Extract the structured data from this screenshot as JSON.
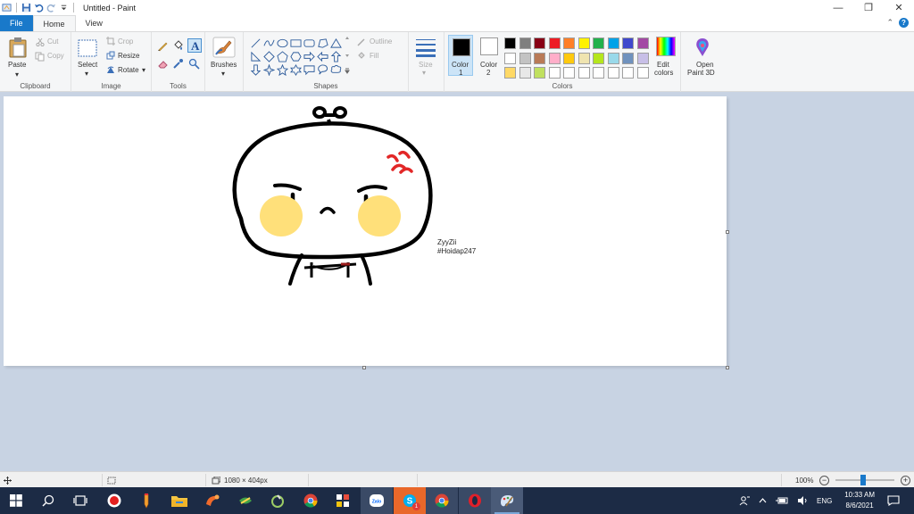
{
  "window": {
    "title": "Untitled - Paint",
    "minimize": "—",
    "restore": "❐",
    "close": "✕"
  },
  "tabs": [
    {
      "label": "File"
    },
    {
      "label": "Home"
    },
    {
      "label": "View"
    }
  ],
  "ribbon": {
    "clipboard": {
      "paste": "Paste",
      "cut": "Cut",
      "copy": "Copy",
      "group": "Clipboard"
    },
    "image": {
      "select": "Select",
      "crop": "Crop",
      "resize": "Resize",
      "rotate": "Rotate",
      "group": "Image"
    },
    "tools": {
      "group": "Tools"
    },
    "brushes": {
      "label": "Brushes"
    },
    "shapes": {
      "outline": "Outline",
      "fill": "Fill",
      "group": "Shapes"
    },
    "size": {
      "label": "Size"
    },
    "color1": {
      "label": "Color",
      "num": "1",
      "value": "#000000"
    },
    "color2": {
      "label": "Color",
      "num": "2",
      "value": "#ffffff"
    },
    "colors": {
      "group": "Colors",
      "palette": [
        "#000000",
        "#7f7f7f",
        "#880015",
        "#ed1c24",
        "#ff7f27",
        "#fff200",
        "#22b14c",
        "#00a2e8",
        "#3f48cc",
        "#a349a4",
        "#ffffff",
        "#c3c3c3",
        "#b97a57",
        "#ffaec9",
        "#ffc90e",
        "#efe4b0",
        "#b5e61d",
        "#99d9ea",
        "#7092be",
        "#c8bfe7",
        "#ffd966",
        "#e8e8e8",
        "#c0e060",
        "#ffffff",
        "#ffffff",
        "#ffffff",
        "#ffffff",
        "#ffffff",
        "#ffffff",
        "#ffffff"
      ]
    },
    "edit_colors": {
      "line1": "Edit",
      "line2": "colors"
    },
    "paint3d": {
      "line1": "Open",
      "line2": "Paint 3D"
    }
  },
  "canvas": {
    "caption_line1": "ZyyZii",
    "caption_line2": "#Hoidap247"
  },
  "statusbar": {
    "dimensions": "1080 × 404px",
    "zoom": "100%"
  },
  "taskbar": {
    "tray_lang": "ENG",
    "time": "10:33 AM",
    "date": "8/6/2021",
    "badge": "1",
    "apps": [
      "start-icon",
      "search-icon",
      "task-view-icon",
      "record-app-icon",
      "pencil-app-icon",
      "file-explorer-icon",
      "app-orange-icon",
      "app-green-icon",
      "app-lime-icon",
      "chrome-icon",
      "app-grid-icon",
      "zalo-icon",
      "skype-icon",
      "chrome-2-icon",
      "opera-icon",
      "paint-icon"
    ]
  }
}
